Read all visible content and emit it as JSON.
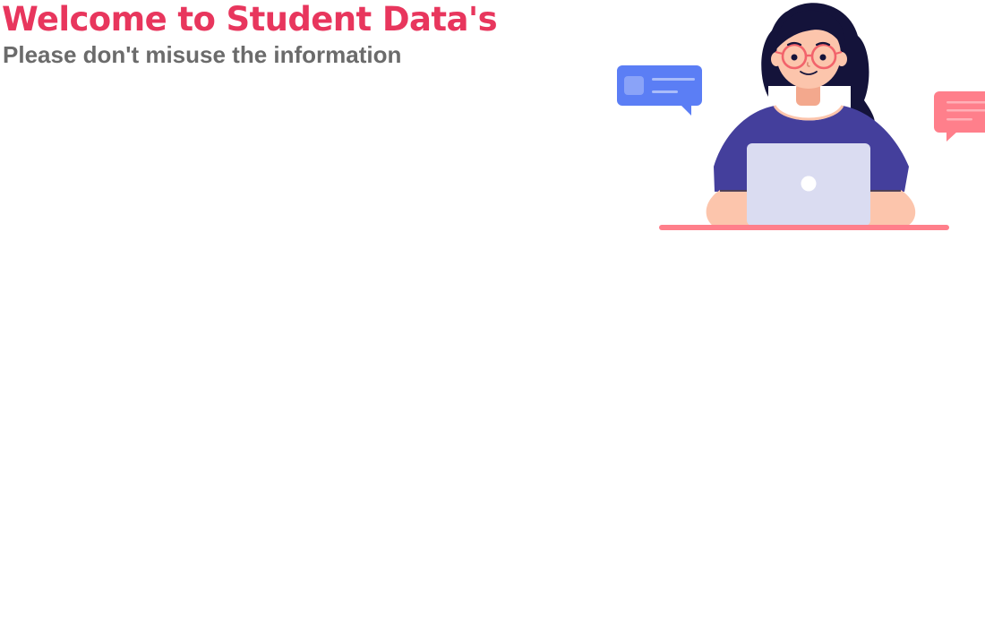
{
  "header": {
    "title": "Welcome to Student Data's",
    "subtitle": "Please don't misuse the information"
  },
  "illustration": {
    "name": "woman-at-laptop-illustration",
    "colors": {
      "title": "#e8365d",
      "subtitle": "#6b6b6b",
      "hair": "#14133a",
      "skin": "#fcc5ac",
      "shirt": "#443f9c",
      "laptop": "#dadcf1",
      "desk": "#ff7f8b",
      "chat_left": "#5b7ef5",
      "chat_right": "#ff7f8b",
      "glasses": "#f2636b"
    }
  }
}
